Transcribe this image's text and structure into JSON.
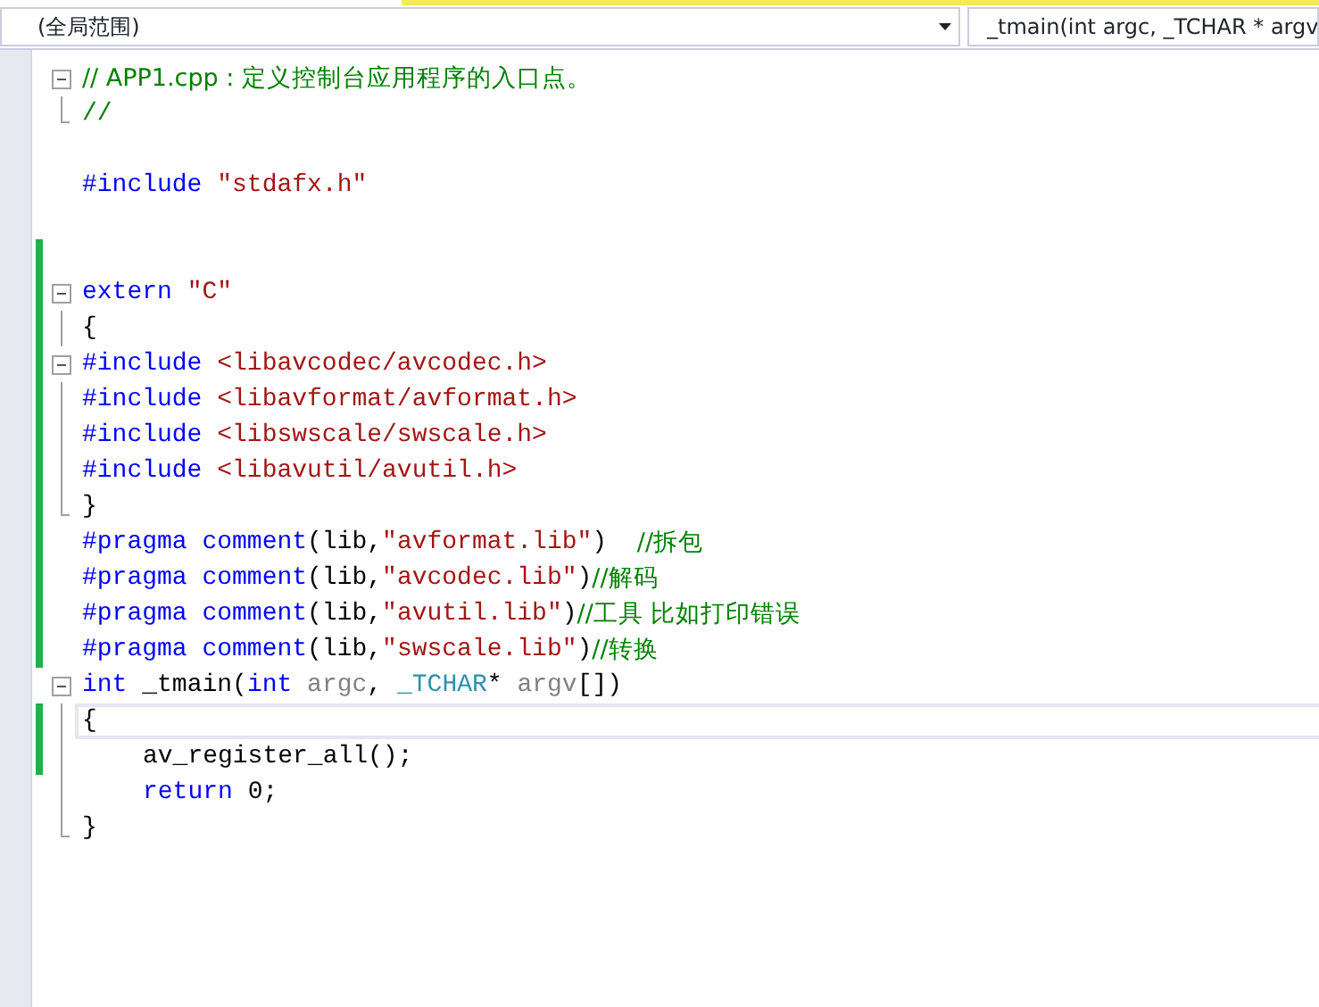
{
  "navigation_bar": {
    "scope": "(全局范围)",
    "member": "_tmain(int argc, _TCHAR * argv"
  },
  "code_lines": [
    {
      "kind": "fold_start",
      "changed": false,
      "current": false,
      "indented": false,
      "tokens": [
        {
          "kind": "comment",
          "text": "// APP1.cpp : 定义控制台应用程序的入口点。"
        }
      ]
    },
    {
      "kind": "fold_end",
      "changed": false,
      "current": false,
      "indented": false,
      "tokens": [
        {
          "kind": "comment",
          "text": "//"
        }
      ]
    },
    {
      "kind": "plain",
      "changed": false,
      "current": false
    },
    {
      "kind": "plain",
      "changed": false,
      "current": false,
      "indented": false,
      "tokens": [
        {
          "kind": "keyword",
          "text": "#include"
        },
        {
          "kind": "string",
          "text": " \"stdafx.h\""
        }
      ]
    },
    {
      "kind": "plain",
      "changed": false,
      "current": false
    },
    {
      "kind": "plain",
      "changed": true,
      "current": false
    },
    {
      "kind": "fold_start",
      "changed": true,
      "current": false,
      "indented": false,
      "tokens": [
        {
          "kind": "keyword",
          "text": "extern"
        },
        {
          "kind": "string",
          "text": " \"C\""
        }
      ]
    },
    {
      "kind": "fold_body",
      "changed": true,
      "current": false,
      "indented": false,
      "tokens": [
        {
          "kind": "plain",
          "text": "{"
        }
      ]
    },
    {
      "kind": "fold_start",
      "changed": true,
      "current": false,
      "indented": false,
      "tokens": [
        {
          "kind": "keyword",
          "text": "#include"
        },
        {
          "kind": "string",
          "text": " <libavcodec/avcodec.h>"
        }
      ]
    },
    {
      "kind": "fold_body",
      "changed": true,
      "current": false,
      "indented": false,
      "tokens": [
        {
          "kind": "keyword",
          "text": "#include"
        },
        {
          "kind": "string",
          "text": " <libavformat/avformat.h>"
        }
      ]
    },
    {
      "kind": "fold_body",
      "changed": true,
      "current": false,
      "indented": false,
      "tokens": [
        {
          "kind": "keyword",
          "text": "#include"
        },
        {
          "kind": "string",
          "text": " <libswscale/swscale.h>"
        }
      ]
    },
    {
      "kind": "fold_body",
      "changed": true,
      "current": false,
      "indented": false,
      "tokens": [
        {
          "kind": "keyword",
          "text": "#include"
        },
        {
          "kind": "string",
          "text": " <libavutil/avutil.h>"
        }
      ]
    },
    {
      "kind": "fold_end",
      "changed": true,
      "current": false,
      "indented": false,
      "tokens": [
        {
          "kind": "plain",
          "text": "}"
        }
      ]
    },
    {
      "kind": "plain",
      "changed": true,
      "current": false,
      "indented": false,
      "tokens": [
        {
          "kind": "keyword",
          "text": "#pragma comment"
        },
        {
          "kind": "plain",
          "text": "(lib,"
        },
        {
          "kind": "string",
          "text": "\"avformat.lib\""
        },
        {
          "kind": "plain",
          "text": ")  "
        },
        {
          "kind": "comment",
          "text": "//拆包"
        }
      ]
    },
    {
      "kind": "plain",
      "changed": true,
      "current": false,
      "indented": false,
      "tokens": [
        {
          "kind": "keyword",
          "text": "#pragma comment"
        },
        {
          "kind": "plain",
          "text": "(lib,"
        },
        {
          "kind": "string",
          "text": "\"avcodec.lib\""
        },
        {
          "kind": "plain",
          "text": ")"
        },
        {
          "kind": "comment",
          "text": "//解码"
        }
      ]
    },
    {
      "kind": "plain",
      "changed": true,
      "current": false,
      "indented": false,
      "tokens": [
        {
          "kind": "keyword",
          "text": "#pragma comment"
        },
        {
          "kind": "plain",
          "text": "(lib,"
        },
        {
          "kind": "string",
          "text": "\"avutil.lib\""
        },
        {
          "kind": "plain",
          "text": ")"
        },
        {
          "kind": "comment",
          "text": "//工具 比如打印错误"
        }
      ]
    },
    {
      "kind": "plain",
      "changed": true,
      "current": false,
      "indented": false,
      "tokens": [
        {
          "kind": "keyword",
          "text": "#pragma comment"
        },
        {
          "kind": "plain",
          "text": "(lib,"
        },
        {
          "kind": "string",
          "text": "\"swscale.lib\""
        },
        {
          "kind": "plain",
          "text": ")"
        },
        {
          "kind": "comment",
          "text": "//转换"
        }
      ]
    },
    {
      "kind": "fold_start",
      "changed": false,
      "current": false,
      "indented": false,
      "tokens": [
        {
          "kind": "keyword",
          "text": "int"
        },
        {
          "kind": "plain",
          "text": " _tmain("
        },
        {
          "kind": "keyword",
          "text": "int"
        },
        {
          "kind": "param",
          "text": " argc"
        },
        {
          "kind": "plain",
          "text": ", "
        },
        {
          "kind": "type",
          "text": "_TCHAR"
        },
        {
          "kind": "plain",
          "text": "*"
        },
        {
          "kind": "param",
          "text": " argv"
        },
        {
          "kind": "plain",
          "text": "[])"
        }
      ]
    },
    {
      "kind": "fold_body",
      "changed": true,
      "current": true,
      "indented": false,
      "tokens": [
        {
          "kind": "plain",
          "text": "{"
        }
      ]
    },
    {
      "kind": "fold_body",
      "changed": true,
      "current": false,
      "indented": true,
      "tokens": [
        {
          "kind": "plain",
          "text": "av_register_all();"
        }
      ]
    },
    {
      "kind": "fold_body",
      "changed": false,
      "current": false,
      "indented": true,
      "tokens": [
        {
          "kind": "keyword",
          "text": "return"
        },
        {
          "kind": "plain",
          "text": " 0;"
        }
      ]
    },
    {
      "kind": "fold_end",
      "changed": false,
      "current": false,
      "indented": false,
      "tokens": [
        {
          "kind": "plain",
          "text": "}"
        }
      ]
    }
  ]
}
